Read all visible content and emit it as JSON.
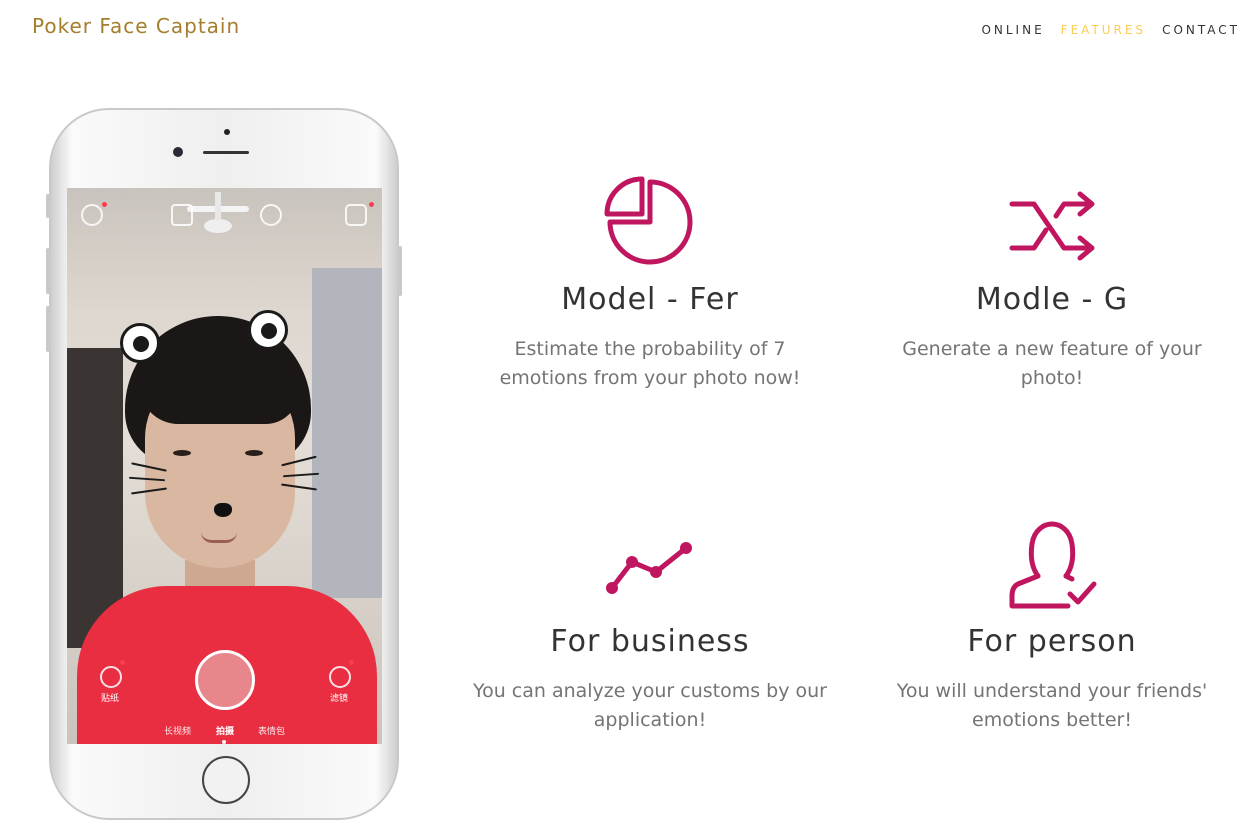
{
  "brand": "Poker Face Captain",
  "nav": [
    {
      "label": "ONLINE",
      "active": false
    },
    {
      "label": "FEATURES",
      "active": true
    },
    {
      "label": "CONTACT",
      "active": false
    }
  ],
  "colors": {
    "brand": "#a47e2c",
    "nav_active": "#fdcc52",
    "icon": "#c0165f",
    "heading": "#333333",
    "body_text": "#747474"
  },
  "phone_screen": {
    "left_button_label": "贴纸",
    "right_button_label": "滤镜",
    "modes": [
      "长视频",
      "拍摄",
      "表情包"
    ],
    "active_mode": "拍摄"
  },
  "features": [
    {
      "icon": "pie-chart-icon",
      "title": "Model - Fer",
      "text": "Estimate the probability of 7 emotions from your photo now!"
    },
    {
      "icon": "shuffle-icon",
      "title": "Modle - G",
      "text": "Generate a new feature of your photo!"
    },
    {
      "icon": "line-chart-icon",
      "title": "For business",
      "text": "You can analyze your customs by our application!"
    },
    {
      "icon": "user-check-icon",
      "title": "For person",
      "text": "You will understand your friends' emotions better!"
    }
  ]
}
